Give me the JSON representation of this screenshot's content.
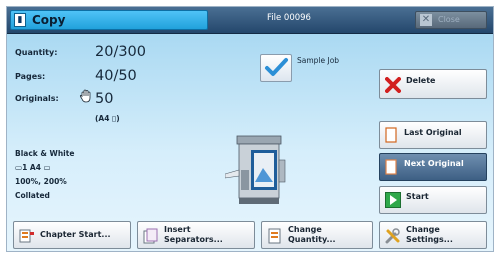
{
  "header": {
    "title": "Copy",
    "file_name": "File 00096",
    "close_label": "Close"
  },
  "settings": {
    "quantity_label": "Quantity:",
    "quantity_value": "20/300",
    "pages_label": "Pages:",
    "pages_value": "40/50",
    "originals_label": "Originals:",
    "originals_value": "50",
    "paper_size": "(A4 ▯)",
    "color_mode": "Black & White",
    "tray_info": "▭1  A4 ▭",
    "reduction": "100%, 200%",
    "finishing": "Collated"
  },
  "sample_job": {
    "label": "Sample Job",
    "checked": true
  },
  "actions": {
    "delete_label": "Delete",
    "last_original_label": "Last Original",
    "next_original_label": "Next Original",
    "start_label": "Start"
  },
  "bottom": {
    "chapter_start": "Chapter Start...",
    "insert_separators_1": "Insert",
    "insert_separators_2": "Separators...",
    "change_quantity_1": "Change",
    "change_quantity_2": "Quantity...",
    "change_settings_1": "Change",
    "change_settings_2": "Settings..."
  },
  "icons": {
    "title": "copy-doc-icon",
    "close": "close-x-icon",
    "delete": "red-x-icon",
    "last_original": "page-icon",
    "next_original": "page-icon",
    "start": "start-arrow-icon",
    "chapter": "chapter-icon",
    "separator": "separator-icon",
    "quantity": "quantity-icon",
    "settings": "tools-icon"
  },
  "colors": {
    "title_tab": "#21a1db",
    "selected_button": "#3d5f84",
    "delete_red": "#d21f1f",
    "start_green": "#2fa84a"
  }
}
